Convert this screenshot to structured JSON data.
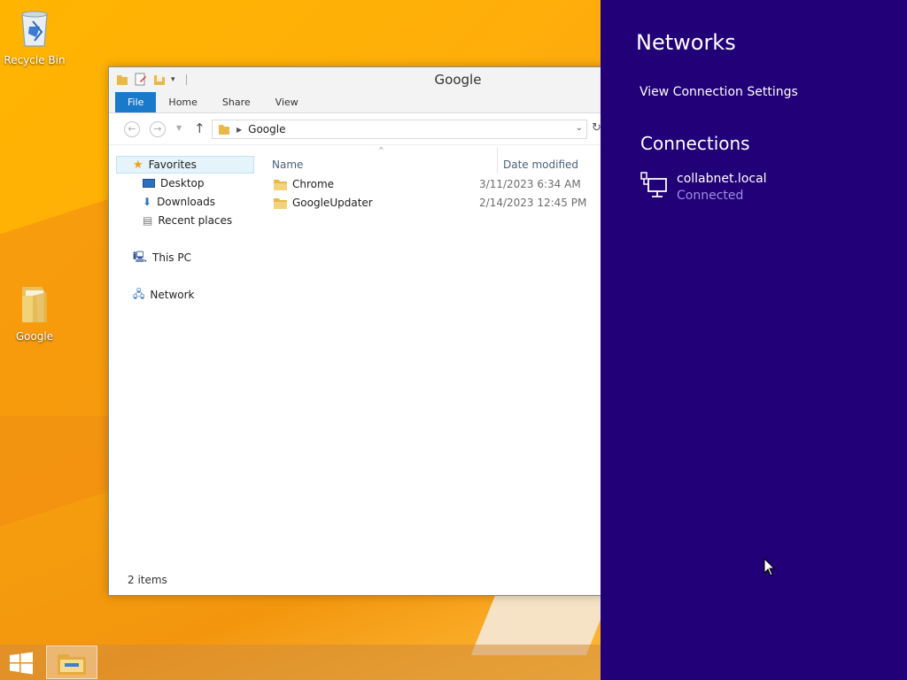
{
  "desktop": {
    "icons": [
      {
        "label": "Recycle Bin"
      },
      {
        "label": "Google"
      }
    ]
  },
  "window": {
    "title": "Google",
    "tabs": [
      {
        "label": "File"
      },
      {
        "label": "Home"
      },
      {
        "label": "Share"
      },
      {
        "label": "View"
      }
    ],
    "address": {
      "crumb": "Google"
    },
    "navpane": {
      "favorites": "Favorites",
      "desktop": "Desktop",
      "downloads": "Downloads",
      "recent": "Recent places",
      "thispc": "This PC",
      "network": "Network"
    },
    "columns": {
      "name": "Name",
      "date": "Date modified"
    },
    "files": [
      {
        "name": "Chrome",
        "date": "3/11/2023 6:34 AM"
      },
      {
        "name": "GoogleUpdater",
        "date": "2/14/2023 12:45 PM"
      }
    ],
    "status": "2 items"
  },
  "networks": {
    "title": "Networks",
    "settings_link": "View Connection Settings",
    "connections_heading": "Connections",
    "connection": {
      "name": "collabnet.local",
      "status": "Connected"
    }
  },
  "colors": {
    "panel_bg": "#220077",
    "file_tab": "#1979ca",
    "desktop_bg": "#ffb400",
    "connected_text": "#9b8ee0"
  }
}
